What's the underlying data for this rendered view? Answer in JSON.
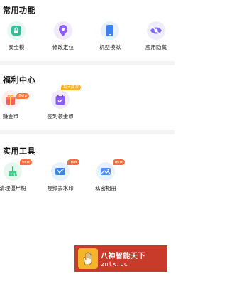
{
  "sections": {
    "common": {
      "title": "常用功能",
      "items": [
        {
          "label": "安全锁",
          "icon": "lock-icon"
        },
        {
          "label": "修改定位",
          "icon": "location-pin-icon"
        },
        {
          "label": "机型模拟",
          "icon": "phone-icon"
        },
        {
          "label": "应用隐藏",
          "icon": "eye-hidden-icon"
        }
      ]
    },
    "welfare": {
      "title": "福利中心",
      "items": [
        {
          "label": "赚金币",
          "icon": "gift-box-icon",
          "badge": "8vip"
        },
        {
          "label": "签到领金币",
          "icon": "calendar-check-icon",
          "badge": "每天两次"
        }
      ]
    },
    "tools": {
      "title": "实用工具",
      "items": [
        {
          "label": "清理僵尸粉",
          "icon": "broom-icon",
          "badge": "new"
        },
        {
          "label": "视频去水印",
          "icon": "video-watermark-icon",
          "badge": "new"
        },
        {
          "label": "私密相册",
          "icon": "photo-album-icon",
          "badge": "new"
        }
      ]
    }
  },
  "watermark": {
    "title": "八神智能天下",
    "url": "zntx.cc"
  },
  "colors": {
    "green": "#2bc29a",
    "purple": "#8b5cf6",
    "blue": "#3b82f6",
    "orange": "#ff7a3a",
    "banner": "#c83b2a"
  }
}
